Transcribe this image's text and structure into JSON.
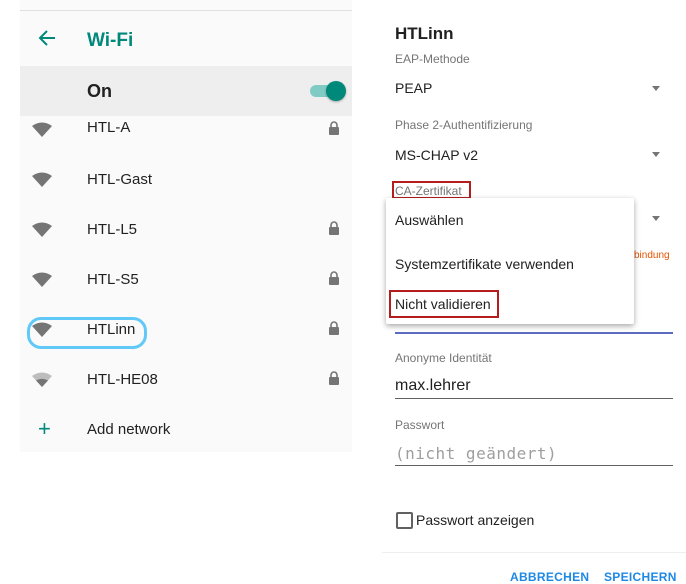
{
  "wifi_screen": {
    "title": "Wi-Fi",
    "master_switch": {
      "label": "On",
      "state": "on"
    },
    "networks": [
      {
        "ssid": "HTL-A",
        "secured": true
      },
      {
        "ssid": "HTL-Gast",
        "secured": false
      },
      {
        "ssid": "HTL-L5",
        "secured": true
      },
      {
        "ssid": "HTL-S5",
        "secured": true
      },
      {
        "ssid": "HTLinn",
        "secured": true
      },
      {
        "ssid": "HTL-HE08",
        "secured": true
      }
    ],
    "add_network_label": "Add network",
    "accent_color": "#00897b"
  },
  "dialog": {
    "title": "HTLinn",
    "eap_method": {
      "label": "EAP-Methode",
      "value": "PEAP"
    },
    "phase2": {
      "label": "Phase 2-Authentifizierung",
      "value": "MS-CHAP v2"
    },
    "ca_cert": {
      "label": "CA-Zertifikat"
    },
    "connection_warning": "bindung",
    "anon_identity": {
      "label": "Anonyme Identität",
      "value": "max.lehrer"
    },
    "password": {
      "label": "Passwort",
      "placeholder": "(nicht geändert)"
    },
    "show_password_label": "Passwort anzeigen",
    "cancel_label": "ABBRECHEN",
    "save_label": "SPEICHERN"
  },
  "ca_dropdown": {
    "options": [
      "Auswählen",
      "Systemzertifikate verwenden",
      "Nicht validieren"
    ]
  },
  "annotation_colors": {
    "circle": "#4fc3f7",
    "box": "#b71c1c"
  }
}
